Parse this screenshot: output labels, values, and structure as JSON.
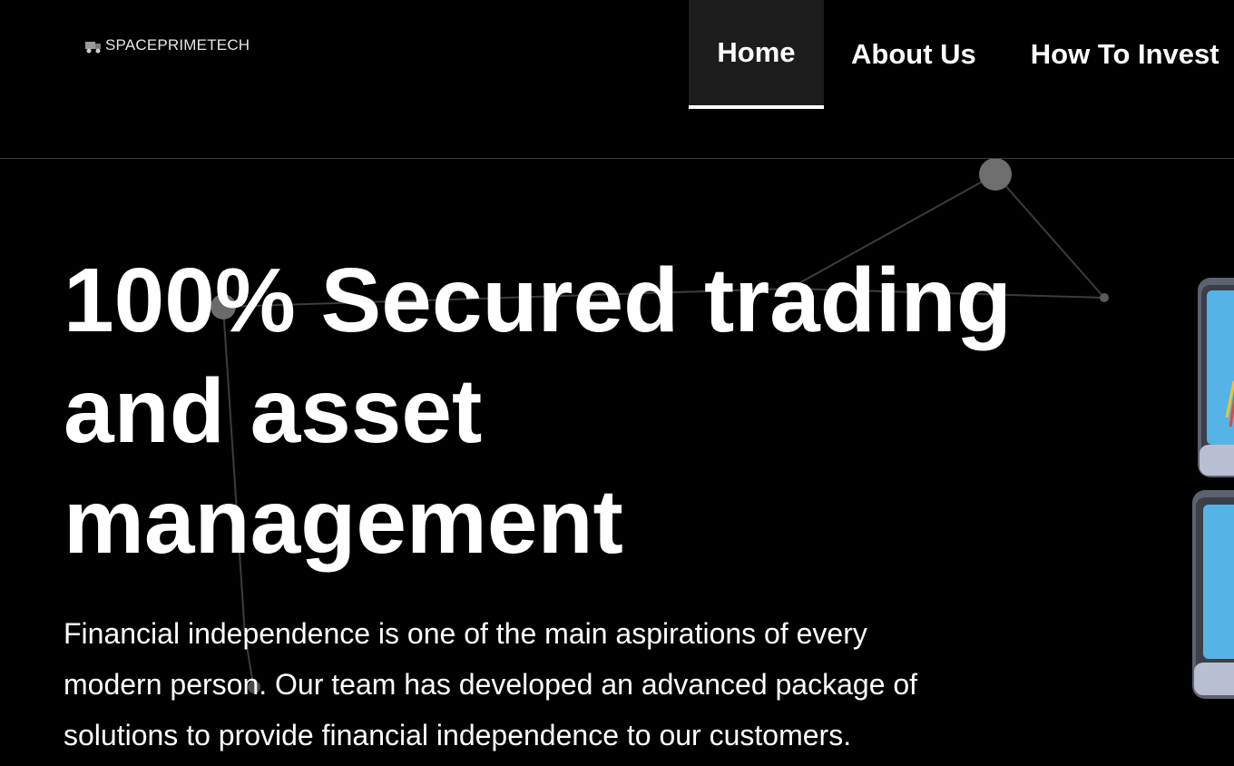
{
  "header": {
    "logo_text": "SPACEPRIMETECH",
    "nav": [
      {
        "label": "Home",
        "active": true
      },
      {
        "label": "About Us",
        "active": false
      },
      {
        "label": "How To Invest",
        "active": false
      }
    ]
  },
  "hero": {
    "title_lines": [
      "100% Secured trading",
      "and asset",
      "management"
    ],
    "description_lines": [
      "Financial independence is one of the main aspirations of every",
      "modern person. Our team has developed an advanced package of",
      "solutions to provide financial independence to our customers."
    ]
  },
  "colors": {
    "background": "#000000",
    "text": "#ffffff",
    "nav_active_bg": "#1d1d1d",
    "header_divider": "#3a3a3a"
  },
  "icons": {
    "logo": "truck-logo-icon"
  }
}
